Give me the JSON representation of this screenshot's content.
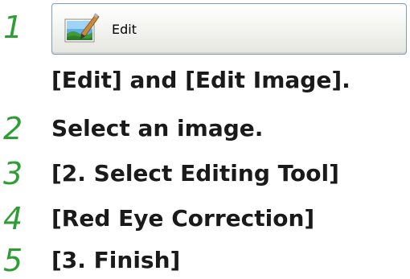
{
  "steps": [
    {
      "number": "1",
      "button_label": "Edit",
      "note": "[Edit] and [Edit Image]."
    },
    {
      "number": "2",
      "text": "Select an image."
    },
    {
      "number": "3",
      "text": "[2. Select Editing Tool]"
    },
    {
      "number": "4",
      "text": "[Red Eye Correction]"
    },
    {
      "number": "5",
      "text": "[3. Finish]"
    }
  ],
  "colors": {
    "step_number": "#2e9e34",
    "text": "#1a1a1a",
    "button_border": "#7f9db9"
  },
  "icons": {
    "edit_button": "edit-image-icon"
  }
}
